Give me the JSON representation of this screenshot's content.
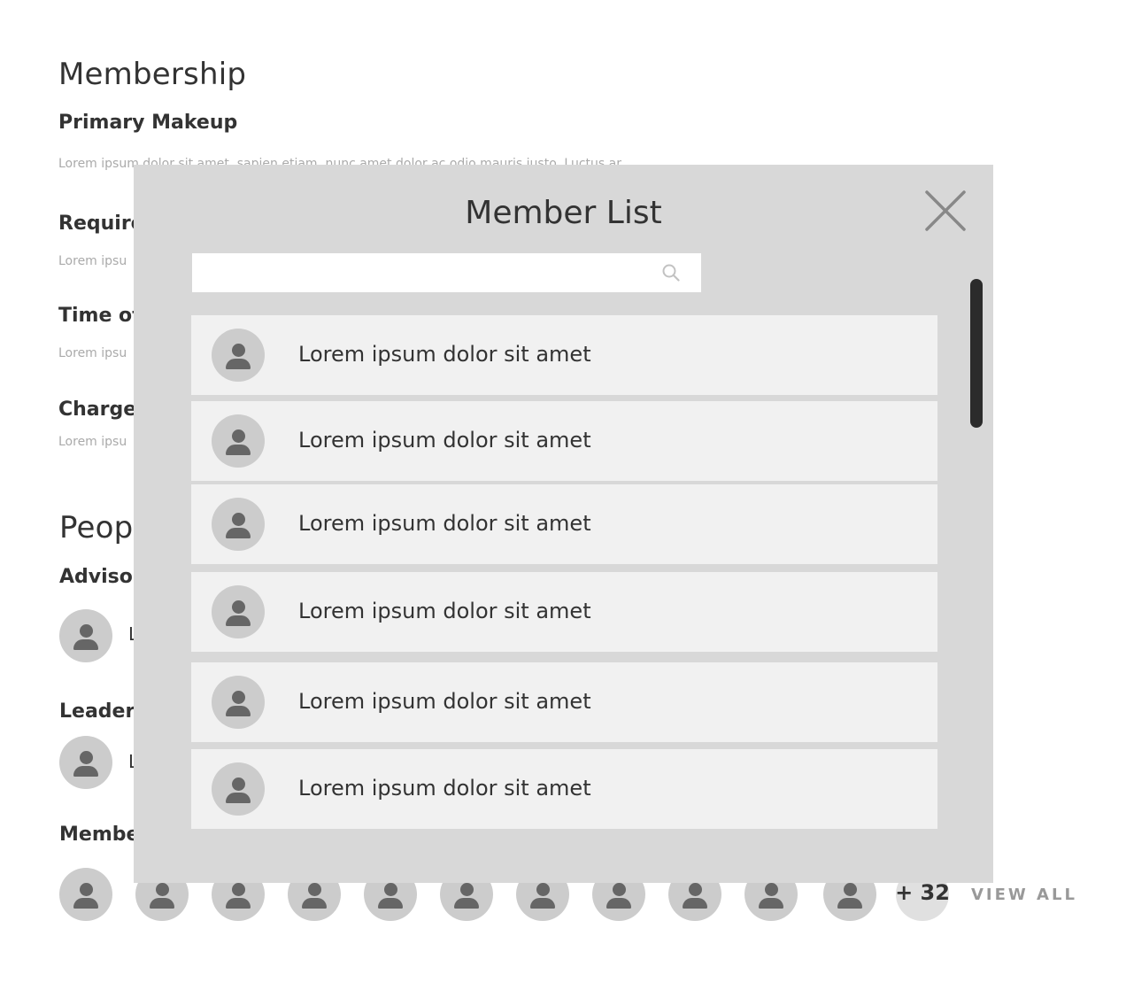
{
  "page": {
    "membership_title": "Membership",
    "primary_makeup_heading": "Primary Makeup",
    "primary_makeup_text": "Lorem ipsum dolor sit amet, sapien etiam, nunc amet dolor ac odio mauris justo. Luctus ar",
    "requirements_heading": "Require",
    "requirements_text": "Lorem ipsu",
    "time_heading": "Time of",
    "time_text": "Lorem ipsu",
    "charge_heading": "Charge",
    "charge_text": "Lorem ipsu",
    "people_title": "Peop",
    "advisor_heading": "Advisor",
    "advisor_name_fragment": "L",
    "leaders_heading": "Leaders",
    "leader_name_fragment": "L",
    "members_heading": "Membe",
    "members_extra_count": "+ 32",
    "view_all_label": "VIEW ALL",
    "member_avatar_icon": "user-icon"
  },
  "modal": {
    "title": "Member List",
    "close_icon": "close-icon",
    "search": {
      "placeholder": "",
      "value": "",
      "icon": "search-icon"
    },
    "members": [
      {
        "name": "Lorem ipsum dolor sit amet",
        "avatar": "user-icon"
      },
      {
        "name": "Lorem ipsum dolor sit amet",
        "avatar": "user-icon"
      },
      {
        "name": "Lorem ipsum dolor sit amet",
        "avatar": "user-icon"
      },
      {
        "name": "Lorem ipsum dolor sit amet",
        "avatar": "user-icon"
      },
      {
        "name": "Lorem ipsum dolor sit amet",
        "avatar": "user-icon"
      },
      {
        "name": "Lorem ipsum dolor sit amet",
        "avatar": "user-icon"
      }
    ]
  },
  "colors": {
    "overlay_bg": "#d8d8d8",
    "row_bg": "#f1f1f1",
    "avatar_bg": "#cccccc",
    "avatar_fg": "#666666",
    "scrollbar": "#2b2b2b",
    "muted_text": "#aaaaaa"
  }
}
